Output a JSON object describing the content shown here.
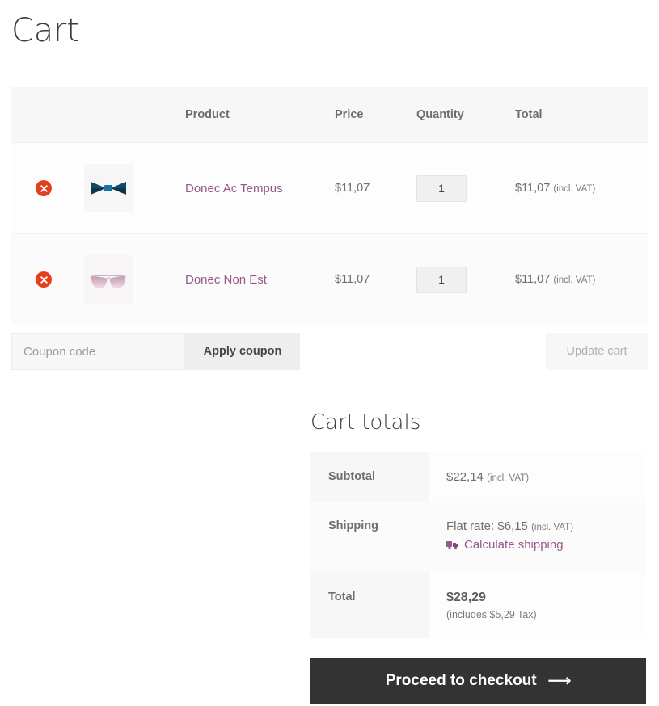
{
  "page": {
    "title": "Cart"
  },
  "cart_table": {
    "columns": [
      "",
      "",
      "Product",
      "Price",
      "Quantity",
      "Total"
    ],
    "rows": [
      {
        "remove_label": "×",
        "remove_title": "Remove this item",
        "thumb_name": "bow-tie",
        "name": "Donec Ac Tempus",
        "price": "$11,07",
        "quantity": "1",
        "total": "$11,07",
        "total_suffix": "(incl. VAT)"
      },
      {
        "remove_label": "×",
        "remove_title": "Remove this item",
        "thumb_name": "sunglasses",
        "name": "Donec Non Est",
        "price": "$11,07",
        "quantity": "1",
        "total": "$11,07",
        "total_suffix": "(incl. VAT)"
      }
    ]
  },
  "coupon": {
    "placeholder": "Coupon code",
    "value": "",
    "apply_label": "Apply coupon",
    "update_label": "Update cart"
  },
  "totals": {
    "title": "Cart totals",
    "subtotal_label": "Subtotal",
    "subtotal_value": "$22,14",
    "subtotal_suffix": "(incl. VAT)",
    "shipping_label": "Shipping",
    "shipping_value": "Flat rate: $6,15",
    "shipping_suffix": "(incl. VAT)",
    "calculate_shipping_label": "Calculate shipping",
    "total_label": "Total",
    "total_value": "$28,29",
    "total_tax_note": "(includes $5,29 Tax)"
  },
  "checkout": {
    "label": "Proceed to checkout",
    "arrow": "⟶"
  },
  "colors": {
    "accent_link": "#96588a",
    "remove_red": "#e2401c",
    "checkout_bg": "#333333",
    "header_bg": "#f7f7f7"
  }
}
